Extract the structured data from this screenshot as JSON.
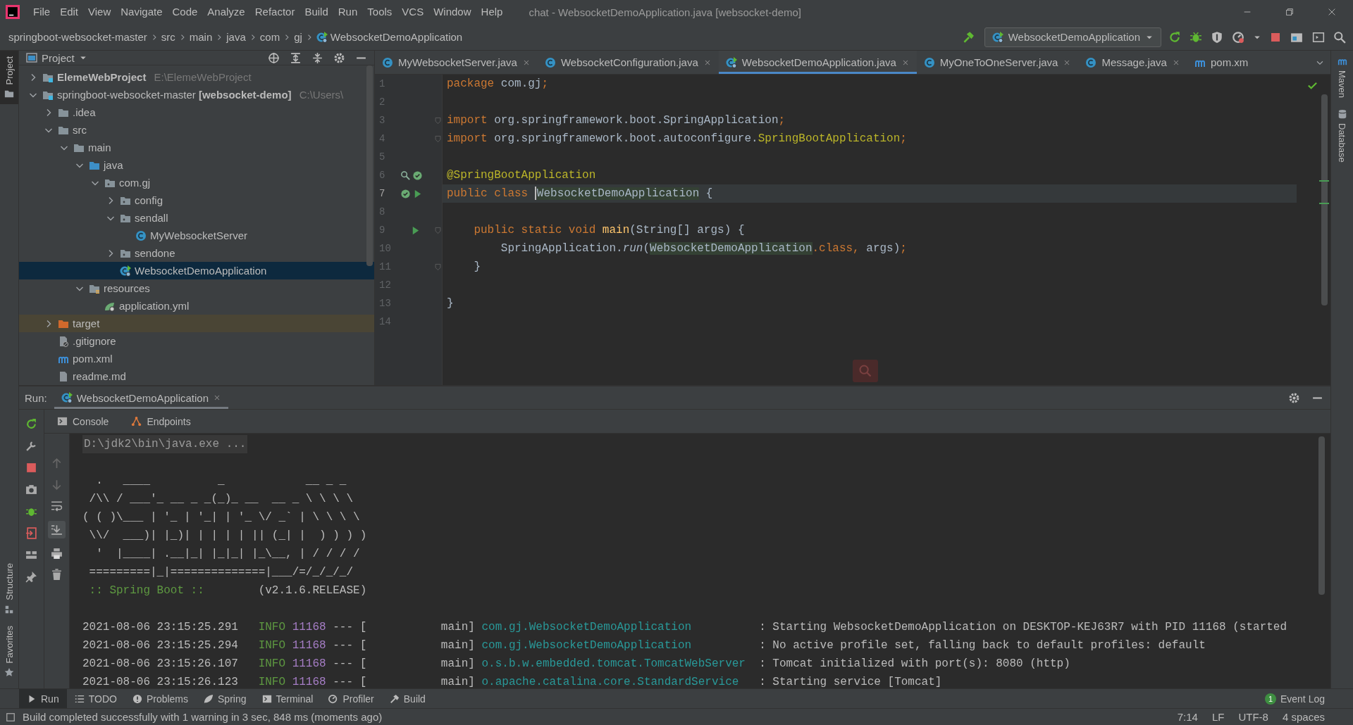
{
  "window": {
    "title": "chat - WebsocketDemoApplication.java [websocket-demo]"
  },
  "menu": [
    "File",
    "Edit",
    "View",
    "Navigate",
    "Code",
    "Analyze",
    "Refactor",
    "Build",
    "Run",
    "Tools",
    "VCS",
    "Window",
    "Help"
  ],
  "breadcrumbs": [
    {
      "label": "springboot-websocket-master",
      "kind": "module"
    },
    {
      "label": "src",
      "kind": "folder"
    },
    {
      "label": "main",
      "kind": "folder"
    },
    {
      "label": "java",
      "kind": "folder"
    },
    {
      "label": "com",
      "kind": "folder"
    },
    {
      "label": "gj",
      "kind": "folder"
    },
    {
      "label": "WebsocketDemoApplication",
      "kind": "spring-class"
    }
  ],
  "run_config": {
    "label": "WebsocketDemoApplication"
  },
  "left_stripe": [
    {
      "label": "Project",
      "kind": "project",
      "selected": true
    },
    {
      "label": "Structure",
      "kind": "structure",
      "selected": false
    },
    {
      "label": "Favorites",
      "kind": "favorites",
      "selected": false
    }
  ],
  "right_stripe": [
    {
      "label": "Maven",
      "kind": "maven"
    },
    {
      "label": "Database",
      "kind": "database"
    }
  ],
  "project_panel": {
    "title": "Project",
    "tree": [
      {
        "label": "ElemeWebProject",
        "bold": true,
        "hint": "E:\\ElemeWebProject",
        "kind": "module",
        "expanded": false,
        "selected": false
      },
      {
        "label": "springboot-websocket-master **[websocket-demo]**",
        "bold": false,
        "hint": "C:\\Users\\",
        "kind": "module",
        "expanded": true,
        "selected": false,
        "children": [
          {
            "label": ".idea",
            "kind": "folder",
            "expanded": false,
            "selected": false
          },
          {
            "label": "src",
            "kind": "folder",
            "expanded": true,
            "selected": false,
            "children": [
              {
                "label": "main",
                "kind": "folder",
                "expanded": true,
                "selected": false,
                "children": [
                  {
                    "label": "java",
                    "kind": "source-folder",
                    "expanded": true,
                    "selected": false,
                    "children": [
                      {
                        "label": "com.gj",
                        "kind": "package",
                        "expanded": true,
                        "selected": false,
                        "children": [
                          {
                            "label": "config",
                            "kind": "package",
                            "expanded": false,
                            "selected": false
                          },
                          {
                            "label": "sendall",
                            "kind": "package",
                            "expanded": true,
                            "selected": false,
                            "children": [
                              {
                                "label": "MyWebsocketServer",
                                "kind": "class",
                                "selected": false
                              }
                            ]
                          },
                          {
                            "label": "sendone",
                            "kind": "package",
                            "expanded": false,
                            "selected": false
                          },
                          {
                            "label": "WebsocketDemoApplication",
                            "kind": "spring-class",
                            "selected": true
                          }
                        ]
                      }
                    ]
                  },
                  {
                    "label": "resources",
                    "kind": "resources",
                    "expanded": true,
                    "selected": false,
                    "children": [
                      {
                        "label": "application.yml",
                        "kind": "yml",
                        "selected": false
                      }
                    ]
                  }
                ]
              }
            ]
          },
          {
            "label": "target",
            "kind": "excluded",
            "expanded": false,
            "selected": false
          },
          {
            "label": ".gitignore",
            "kind": "gitignore",
            "selected": false
          },
          {
            "label": "pom.xml",
            "kind": "maven",
            "selected": false
          },
          {
            "label": "readme.md",
            "kind": "file",
            "selected": false
          }
        ]
      }
    ]
  },
  "editor": {
    "tabs": [
      {
        "label": "MyWebsocketServer.java",
        "kind": "class",
        "selected": false,
        "closable": true
      },
      {
        "label": "WebsocketConfiguration.java",
        "kind": "class",
        "selected": false,
        "closable": true
      },
      {
        "label": "WebsocketDemoApplication.java",
        "kind": "spring-class",
        "selected": true,
        "closable": true
      },
      {
        "label": "MyOneToOneServer.java",
        "kind": "class",
        "selected": false,
        "closable": true
      },
      {
        "label": "Message.java",
        "kind": "class",
        "selected": false,
        "closable": true
      },
      {
        "label": "pom.xm",
        "kind": "maven",
        "selected": false,
        "closable": false
      }
    ],
    "lines": [
      {
        "n": "1",
        "current": false,
        "fold": false,
        "tokens": [
          {
            "kind": "kw",
            "text": "package"
          },
          {
            "kind": "plain",
            "text": " com.gj"
          },
          {
            "kind": "kw",
            "text": ";"
          }
        ]
      },
      {
        "n": "2",
        "current": false,
        "fold": false
      },
      {
        "n": "3",
        "current": false,
        "fold": true,
        "tokens": [
          {
            "kind": "kw",
            "text": "import"
          },
          {
            "kind": "plain",
            "text": " org.springframework.boot.SpringApplication"
          },
          {
            "kind": "kw",
            "text": ";"
          }
        ]
      },
      {
        "n": "4",
        "current": false,
        "fold": true,
        "tokens": [
          {
            "kind": "kw",
            "text": "import"
          },
          {
            "kind": "plain",
            "text": " org.springframework.boot.autoconfigure."
          },
          {
            "kind": "annot",
            "text": "SpringBootApplication"
          },
          {
            "kind": "kw",
            "text": ";"
          }
        ]
      },
      {
        "n": "5",
        "current": false,
        "fold": false
      },
      {
        "n": "6",
        "current": false,
        "fold": false,
        "markers": [
          {
            "kind": "find-bean"
          },
          {
            "kind": "spring-bean"
          }
        ],
        "tokens": [
          {
            "kind": "annot",
            "text": "@SpringBootApplication"
          }
        ]
      },
      {
        "n": "7",
        "current": true,
        "fold": false,
        "markers": [
          {
            "kind": "spring-bean"
          },
          {
            "kind": "run"
          }
        ],
        "tokens": [
          {
            "kind": "kw",
            "text": "public class "
          },
          {
            "kind": "hl",
            "text": "WebsocketDemoApplication"
          },
          {
            "kind": "plain",
            "text": " {"
          }
        ]
      },
      {
        "n": "8",
        "current": false,
        "fold": false
      },
      {
        "n": "9",
        "current": false,
        "fold": true,
        "markers": [
          {
            "kind": "run"
          }
        ],
        "tokens": [
          {
            "kind": "kw",
            "text": "    public static void "
          },
          {
            "kind": "fn",
            "text": "main"
          },
          {
            "kind": "plain",
            "text": "(String[] args) {"
          }
        ]
      },
      {
        "n": "10",
        "current": false,
        "fold": false,
        "tokens": [
          {
            "kind": "plain",
            "text": "        SpringApplication."
          },
          {
            "kind": "italic",
            "text": "run"
          },
          {
            "kind": "plain",
            "text": "("
          },
          {
            "kind": "hl",
            "text": "WebsocketDemoApplication"
          },
          {
            "kind": "kw",
            "text": ".class, "
          },
          {
            "kind": "plain",
            "text": "args)"
          },
          {
            "kind": "kw",
            "text": ";"
          }
        ]
      },
      {
        "n": "11",
        "current": false,
        "fold": true,
        "tokens": [
          {
            "kind": "plain",
            "text": "    }"
          }
        ]
      },
      {
        "n": "12",
        "current": false,
        "fold": false
      },
      {
        "n": "13",
        "current": false,
        "fold": false,
        "tokens": [
          {
            "kind": "plain",
            "text": "}"
          }
        ]
      },
      {
        "n": "14",
        "current": false,
        "fold": false
      }
    ]
  },
  "run_panel": {
    "label": "Run:",
    "tab": "WebsocketDemoApplication",
    "subtabs": [
      {
        "label": "Console",
        "kind": "console"
      },
      {
        "label": "Endpoints",
        "kind": "endpoints"
      }
    ],
    "console": [
      {
        "kind": "command",
        "text": "D:\\jdk2\\bin\\java.exe ..."
      },
      {
        "kind": "blank"
      },
      {
        "kind": "banner",
        "text": "  .   ____          _            __ _ _"
      },
      {
        "kind": "banner",
        "text": " /\\\\ / ___'_ __ _ _(_)_ __  __ _ \\ \\ \\ \\"
      },
      {
        "kind": "banner",
        "text": "( ( )\\___ | '_ | '_| | '_ \\/ _` | \\ \\ \\ \\"
      },
      {
        "kind": "banner",
        "text": " \\\\/  ___)| |_)| | | | | || (_| |  ) ) ) )"
      },
      {
        "kind": "banner",
        "text": "  '  |____| .__|_| |_|_| |_\\__, | / / / /"
      },
      {
        "kind": "banner",
        "text": " =========|_|==============|___/=/_/_/_/"
      },
      {
        "kind": "version",
        "label": ":: Spring Boot ::",
        "version": "(v2.1.6.RELEASE)"
      },
      {
        "kind": "blank"
      },
      {
        "kind": "log",
        "date": "2021-08-06 23:15:25.291",
        "level": "INFO",
        "pid": "11168",
        "separator": "--- [",
        "thread": "main]",
        "logger": "com.gj.WebsocketDemoApplication",
        "message": ": Starting WebsocketDemoApplication on DESKTOP-KEJ63R7 with PID 11168 (started"
      },
      {
        "kind": "log",
        "date": "2021-08-06 23:15:25.294",
        "level": "INFO",
        "pid": "11168",
        "separator": "--- [",
        "thread": "main]",
        "logger": "com.gj.WebsocketDemoApplication",
        "message": ": No active profile set, falling back to default profiles: default"
      },
      {
        "kind": "log",
        "date": "2021-08-06 23:15:26.107",
        "level": "INFO",
        "pid": "11168",
        "separator": "--- [",
        "thread": "main]",
        "logger": "o.s.b.w.embedded.tomcat.TomcatWebServer",
        "message": ": Tomcat initialized with port(s): 8080 (http)"
      },
      {
        "kind": "log",
        "date": "2021-08-06 23:15:26.123",
        "level": "INFO",
        "pid": "11168",
        "separator": "--- [",
        "thread": "main]",
        "logger": "o.apache.catalina.core.StandardService",
        "message": ": Starting service [Tomcat]"
      }
    ]
  },
  "tool_tabs": [
    {
      "label": "Run",
      "kind": "run",
      "selected": true
    },
    {
      "label": "TODO",
      "kind": "todo",
      "selected": false
    },
    {
      "label": "Problems",
      "kind": "problems",
      "selected": false
    },
    {
      "label": "Spring",
      "kind": "spring",
      "selected": false
    },
    {
      "label": "Terminal",
      "kind": "terminal",
      "selected": false
    },
    {
      "label": "Profiler",
      "kind": "profiler",
      "selected": false
    },
    {
      "label": "Build",
      "kind": "build",
      "selected": false
    }
  ],
  "event_log": {
    "label": "Event Log",
    "count": "1"
  },
  "status_bar": {
    "message": "Build completed successfully with 1 warning in 3 sec, 848 ms (moments ago)",
    "items": [
      "7:14",
      "LF",
      "UTF-8",
      "4 spaces"
    ]
  }
}
